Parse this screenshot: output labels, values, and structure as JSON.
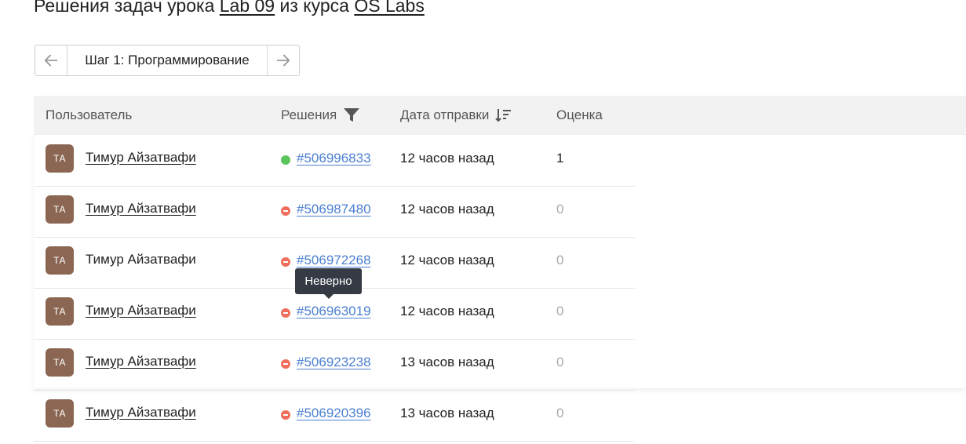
{
  "title": {
    "prefix": "Решения задач урока",
    "lesson_link": "Lab 09",
    "middle": "из курса",
    "course_link": "OS Labs"
  },
  "step_nav": {
    "prev_icon": "arrow-left-icon",
    "label": "Шаг 1: Программирование",
    "next_icon": "arrow-right-icon"
  },
  "table": {
    "headers": {
      "user": "Пользователь",
      "solutions": "Решения",
      "date": "Дата отправки",
      "score": "Оценка"
    },
    "filter_icon": "filter-icon",
    "sort_icon": "sort-descending-icon",
    "rows": [
      {
        "avatar": "ТА",
        "user": "Тимур Айзатвафи",
        "status": "correct",
        "submission": "#506996833",
        "date": "12 часов назад",
        "score": "1"
      },
      {
        "avatar": "ТА",
        "user": "Тимур Айзатвафи",
        "status": "wrong",
        "submission": "#506987480",
        "date": "12 часов назад",
        "score": "0"
      },
      {
        "avatar": "ТА",
        "user": "Тимур Айзатвафи",
        "status": "wrong",
        "submission": "#506972268",
        "date": "12 часов назад",
        "score": "0"
      },
      {
        "avatar": "ТА",
        "user": "Тимур Айзатвафи",
        "status": "wrong",
        "submission": "#506963019",
        "date": "12 часов назад",
        "score": "0"
      },
      {
        "avatar": "ТА",
        "user": "Тимур Айзатвафи",
        "status": "wrong",
        "submission": "#506923238",
        "date": "13 часов назад",
        "score": "0"
      },
      {
        "avatar": "ТА",
        "user": "Тимур Айзатвафи",
        "status": "wrong",
        "submission": "#506920396",
        "date": "13 часов назад",
        "score": "0"
      }
    ]
  },
  "tooltip": {
    "text": "Неверно"
  },
  "colors": {
    "correct": "#5cc45c",
    "wrong": "#f06e5b",
    "link": "#4b7fd1",
    "avatar": "#8a6653",
    "header_bg": "#f2f2f2",
    "tooltip_bg": "#363a45"
  }
}
